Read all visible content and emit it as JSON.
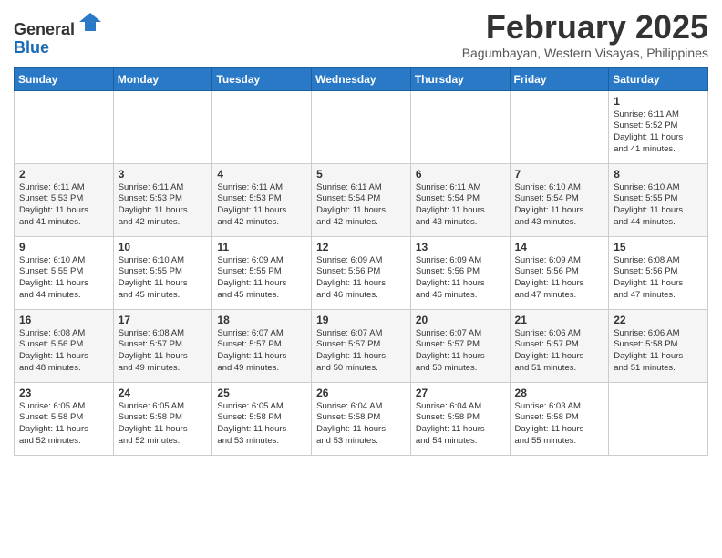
{
  "header": {
    "logo_general": "General",
    "logo_blue": "Blue",
    "title": "February 2025",
    "subtitle": "Bagumbayan, Western Visayas, Philippines"
  },
  "weekdays": [
    "Sunday",
    "Monday",
    "Tuesday",
    "Wednesday",
    "Thursday",
    "Friday",
    "Saturday"
  ],
  "weeks": [
    [
      {
        "day": "",
        "info": ""
      },
      {
        "day": "",
        "info": ""
      },
      {
        "day": "",
        "info": ""
      },
      {
        "day": "",
        "info": ""
      },
      {
        "day": "",
        "info": ""
      },
      {
        "day": "",
        "info": ""
      },
      {
        "day": "1",
        "info": "Sunrise: 6:11 AM\nSunset: 5:52 PM\nDaylight: 11 hours\nand 41 minutes."
      }
    ],
    [
      {
        "day": "2",
        "info": "Sunrise: 6:11 AM\nSunset: 5:53 PM\nDaylight: 11 hours\nand 41 minutes."
      },
      {
        "day": "3",
        "info": "Sunrise: 6:11 AM\nSunset: 5:53 PM\nDaylight: 11 hours\nand 42 minutes."
      },
      {
        "day": "4",
        "info": "Sunrise: 6:11 AM\nSunset: 5:53 PM\nDaylight: 11 hours\nand 42 minutes."
      },
      {
        "day": "5",
        "info": "Sunrise: 6:11 AM\nSunset: 5:54 PM\nDaylight: 11 hours\nand 42 minutes."
      },
      {
        "day": "6",
        "info": "Sunrise: 6:11 AM\nSunset: 5:54 PM\nDaylight: 11 hours\nand 43 minutes."
      },
      {
        "day": "7",
        "info": "Sunrise: 6:10 AM\nSunset: 5:54 PM\nDaylight: 11 hours\nand 43 minutes."
      },
      {
        "day": "8",
        "info": "Sunrise: 6:10 AM\nSunset: 5:55 PM\nDaylight: 11 hours\nand 44 minutes."
      }
    ],
    [
      {
        "day": "9",
        "info": "Sunrise: 6:10 AM\nSunset: 5:55 PM\nDaylight: 11 hours\nand 44 minutes."
      },
      {
        "day": "10",
        "info": "Sunrise: 6:10 AM\nSunset: 5:55 PM\nDaylight: 11 hours\nand 45 minutes."
      },
      {
        "day": "11",
        "info": "Sunrise: 6:09 AM\nSunset: 5:55 PM\nDaylight: 11 hours\nand 45 minutes."
      },
      {
        "day": "12",
        "info": "Sunrise: 6:09 AM\nSunset: 5:56 PM\nDaylight: 11 hours\nand 46 minutes."
      },
      {
        "day": "13",
        "info": "Sunrise: 6:09 AM\nSunset: 5:56 PM\nDaylight: 11 hours\nand 46 minutes."
      },
      {
        "day": "14",
        "info": "Sunrise: 6:09 AM\nSunset: 5:56 PM\nDaylight: 11 hours\nand 47 minutes."
      },
      {
        "day": "15",
        "info": "Sunrise: 6:08 AM\nSunset: 5:56 PM\nDaylight: 11 hours\nand 47 minutes."
      }
    ],
    [
      {
        "day": "16",
        "info": "Sunrise: 6:08 AM\nSunset: 5:56 PM\nDaylight: 11 hours\nand 48 minutes."
      },
      {
        "day": "17",
        "info": "Sunrise: 6:08 AM\nSunset: 5:57 PM\nDaylight: 11 hours\nand 49 minutes."
      },
      {
        "day": "18",
        "info": "Sunrise: 6:07 AM\nSunset: 5:57 PM\nDaylight: 11 hours\nand 49 minutes."
      },
      {
        "day": "19",
        "info": "Sunrise: 6:07 AM\nSunset: 5:57 PM\nDaylight: 11 hours\nand 50 minutes."
      },
      {
        "day": "20",
        "info": "Sunrise: 6:07 AM\nSunset: 5:57 PM\nDaylight: 11 hours\nand 50 minutes."
      },
      {
        "day": "21",
        "info": "Sunrise: 6:06 AM\nSunset: 5:57 PM\nDaylight: 11 hours\nand 51 minutes."
      },
      {
        "day": "22",
        "info": "Sunrise: 6:06 AM\nSunset: 5:58 PM\nDaylight: 11 hours\nand 51 minutes."
      }
    ],
    [
      {
        "day": "23",
        "info": "Sunrise: 6:05 AM\nSunset: 5:58 PM\nDaylight: 11 hours\nand 52 minutes."
      },
      {
        "day": "24",
        "info": "Sunrise: 6:05 AM\nSunset: 5:58 PM\nDaylight: 11 hours\nand 52 minutes."
      },
      {
        "day": "25",
        "info": "Sunrise: 6:05 AM\nSunset: 5:58 PM\nDaylight: 11 hours\nand 53 minutes."
      },
      {
        "day": "26",
        "info": "Sunrise: 6:04 AM\nSunset: 5:58 PM\nDaylight: 11 hours\nand 53 minutes."
      },
      {
        "day": "27",
        "info": "Sunrise: 6:04 AM\nSunset: 5:58 PM\nDaylight: 11 hours\nand 54 minutes."
      },
      {
        "day": "28",
        "info": "Sunrise: 6:03 AM\nSunset: 5:58 PM\nDaylight: 11 hours\nand 55 minutes."
      },
      {
        "day": "",
        "info": ""
      }
    ]
  ]
}
